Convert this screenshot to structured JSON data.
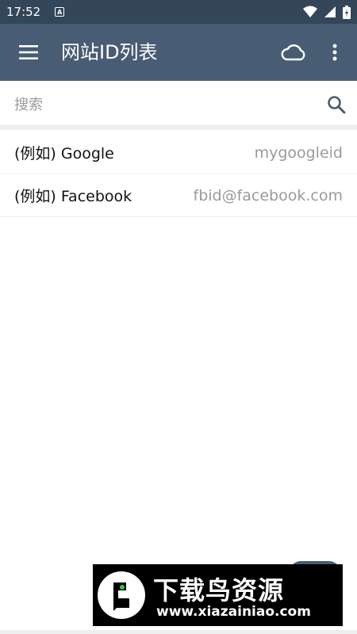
{
  "status_bar": {
    "time": "17:52",
    "indicator": "A",
    "icons": [
      "wifi-icon",
      "signal-icon",
      "battery-icon"
    ]
  },
  "app_bar": {
    "title": "网站ID列表",
    "icons": [
      "menu-icon",
      "cloud-icon",
      "more-vert-icon"
    ],
    "background": "#485d73"
  },
  "search": {
    "placeholder": "搜索",
    "value": ""
  },
  "list": {
    "items": [
      {
        "name": "(例如) Google",
        "id": "mygoogleid"
      },
      {
        "name": "(例如) Facebook",
        "id": "fbid@facebook.com"
      }
    ]
  },
  "watermark": {
    "title": "下载鸟资源",
    "url": "www.xiazainiao.com"
  },
  "colors": {
    "status_bar": "#33465a",
    "app_bar": "#485d73",
    "secondary_text": "#9a9a9a"
  }
}
